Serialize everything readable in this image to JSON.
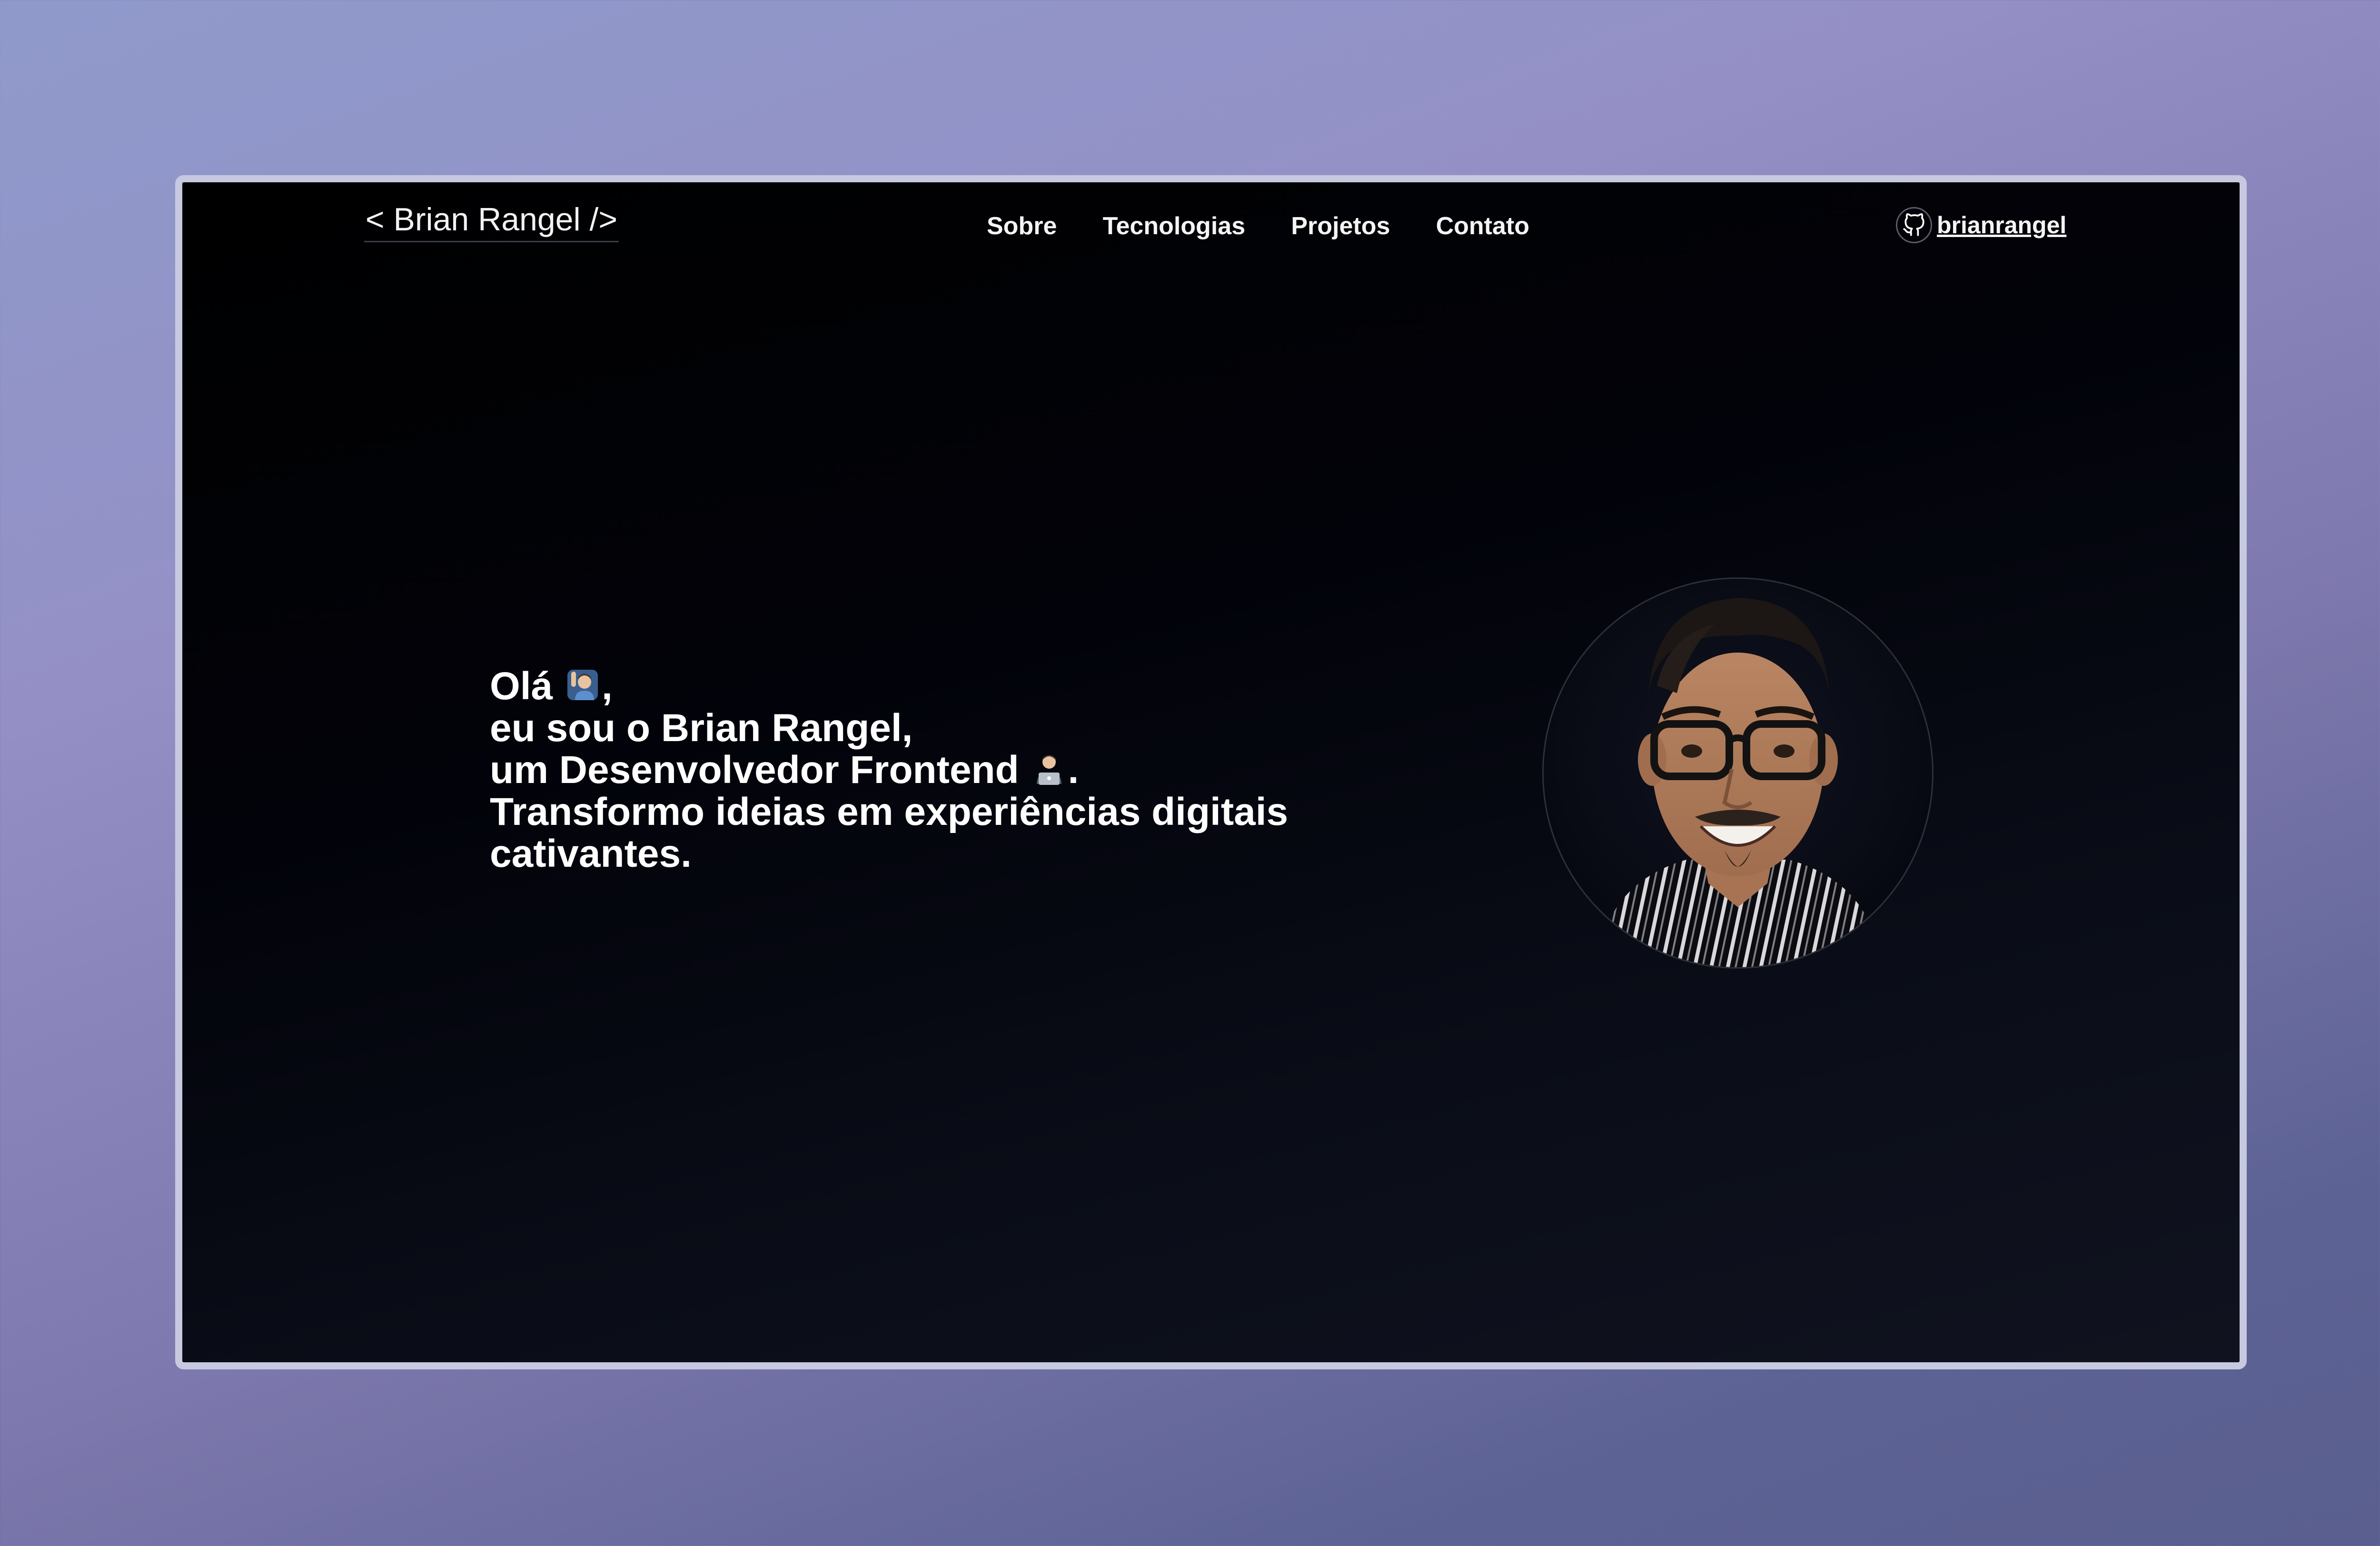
{
  "header": {
    "logo": "< Brian Rangel />",
    "nav": [
      {
        "label": "Sobre"
      },
      {
        "label": "Tecnologias"
      },
      {
        "label": "Projetos"
      },
      {
        "label": "Contato"
      }
    ],
    "github": {
      "icon": "github-icon",
      "username": "brianrangel"
    }
  },
  "hero": {
    "line1": "Olá",
    "line1_emoji": "person-raising-hand",
    "line1_suffix": ",",
    "line2": "eu sou o Brian Rangel,",
    "line3": "um Desenvolvedor Frontend",
    "line3_emoji": "technologist-laptop",
    "line3_suffix": ".",
    "line4": "Transformo ideias em experiências digitais",
    "line5": "cativantes."
  },
  "avatar": {
    "alt": "profile-photo"
  },
  "colors": {
    "background_top": "#8f9acb",
    "background_bottom": "#5a5f8f",
    "window_border": "#c6c9df",
    "page_bg": "#000000",
    "text": "#ffffff"
  }
}
